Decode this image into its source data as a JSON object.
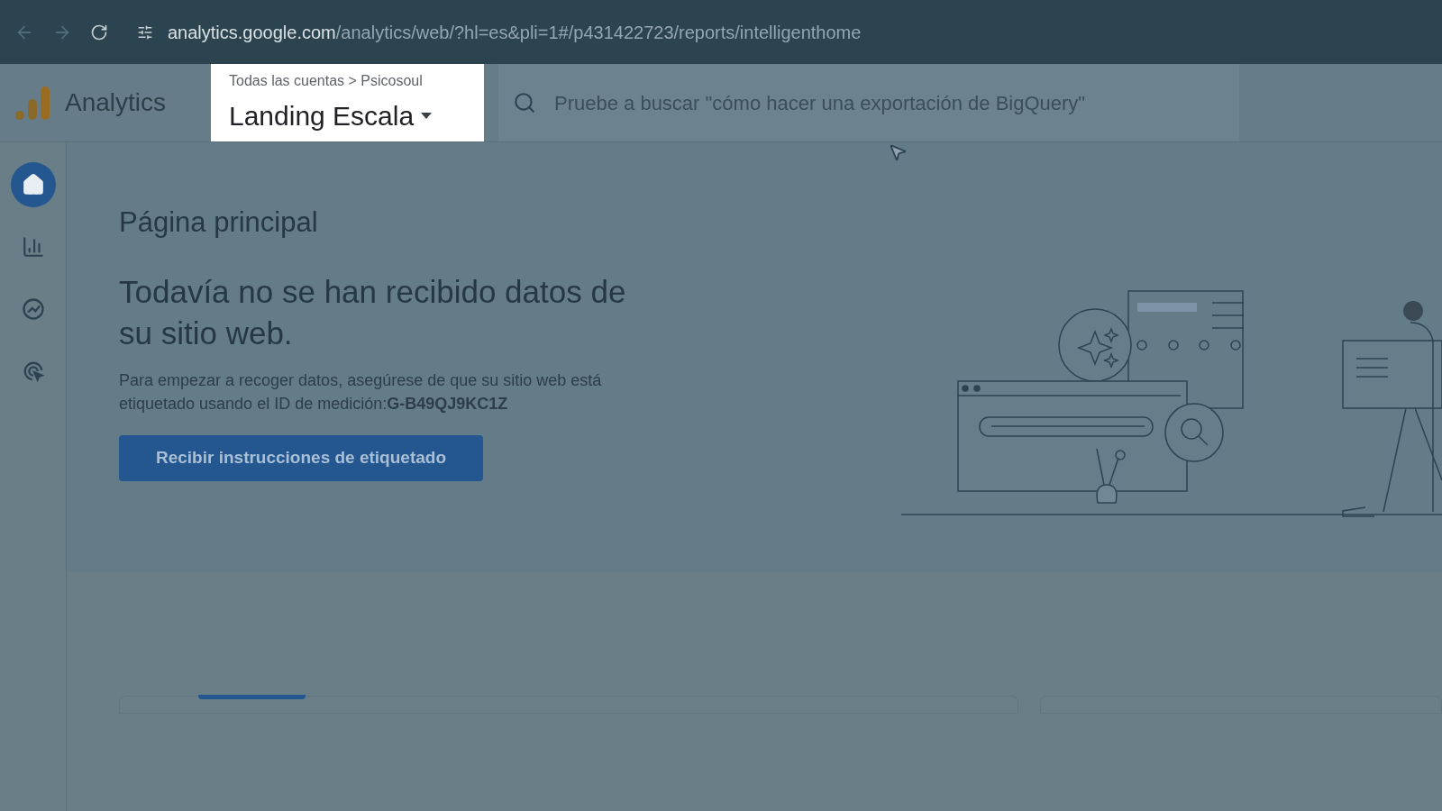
{
  "browser": {
    "url_domain": "analytics.google.com",
    "url_path": "/analytics/web/?hl=es&pli=1#/p431422723/reports/intelligenthome"
  },
  "header": {
    "app_name": "Analytics",
    "breadcrumb": {
      "account": "Todas las cuentas",
      "separator": ">",
      "property": "Psicosoul"
    },
    "property_name": "Landing Escala",
    "search": {
      "placeholder": "Pruebe a buscar \"cómo hacer una exportación de BigQuery\""
    }
  },
  "nav": [
    {
      "selected": true
    },
    {
      "selected": false
    },
    {
      "selected": false
    },
    {
      "selected": false
    }
  ],
  "page": {
    "title": "Página principal",
    "headline": "Todavía no se han recibido datos de su sitio web.",
    "body": "Para empezar a recoger datos, asegúrese de que su sitio web está etiquetado usando el ID de medición:**G-B49QJ9KC1Z**",
    "button": "Recibir instrucciones de etiquetado"
  }
}
